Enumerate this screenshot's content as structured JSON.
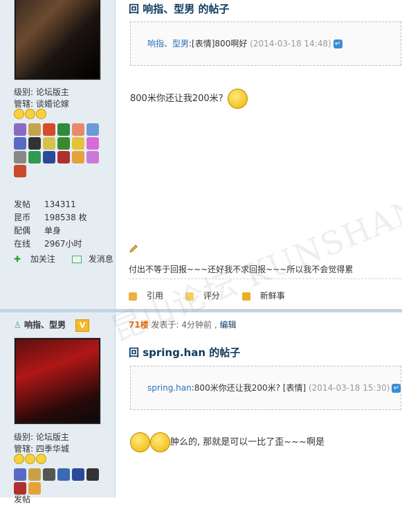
{
  "post1": {
    "title": "回 响指、型男 的帖子",
    "quote": {
      "author": "响指、型男",
      "text": ":[表情]800啊好",
      "date": "(2014-03-18 14:48)"
    },
    "message": "800米你还让我200米?",
    "signature": "付出不等于回报~~~还好我不求回报~~~所以我不会觉得累",
    "tools": {
      "quote": "引用",
      "rate": "评分",
      "fresh": "新鲜事"
    }
  },
  "user1": {
    "rank": "级别: 论坛版主",
    "manage": "管辖: 谈婚论嫁",
    "stats": [
      {
        "k": "发帖",
        "v": "134311"
      },
      {
        "k": "昆币",
        "v": "198538 枚"
      },
      {
        "k": "配偶",
        "v": "单身"
      },
      {
        "k": "在线",
        "v": "2967小时"
      }
    ],
    "follow": "加关注",
    "message": "发消息"
  },
  "post2": {
    "floor": "71楼",
    "posted": "发表于: 4分钟前",
    "edit": "编辑",
    "title": "回 spring.han 的帖子",
    "quote": {
      "author": "spring.han",
      "text": ":800米你还让我200米? [表情]",
      "date": "(2014-03-18 15:30)"
    },
    "message": "肿么的, 那就是可以一比了歪~~~啊是"
  },
  "user2": {
    "name": "响指、型男",
    "badge": "V",
    "rank": "级别: 论坛版主",
    "manage": "管辖: 四季华城",
    "partial_stat": "发帖"
  },
  "watermark": "昆山论坛 KUNSHAN BBS",
  "icons": [
    "reply-icon",
    "pencil-icon",
    "quote-icon",
    "rate-icon",
    "fresh-icon",
    "plus-icon",
    "envelope-icon",
    "user-icon",
    "smiley-icon"
  ],
  "colors": {
    "sidebar": "#e5edf2",
    "title": "#0e3a5e",
    "floor": "#e06b10",
    "link": "#2b6fb5"
  }
}
